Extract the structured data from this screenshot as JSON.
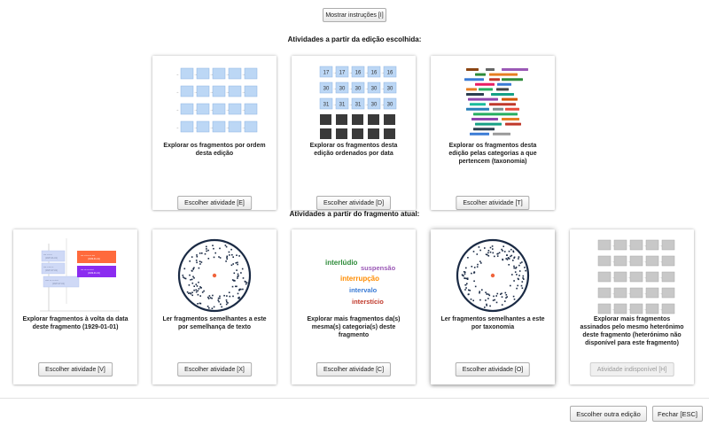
{
  "top": {
    "show_instructions": "Mostrar instruções [I]"
  },
  "sections": {
    "edition": "Atividades a partir da edição escolhida:",
    "fragment": "Atividades a partir do fragmento atual:"
  },
  "edition_cards": [
    {
      "label": "Explorar os fragmentos por ordem desta edição",
      "button": "Escolher atividade [E]"
    },
    {
      "label": "Explorar os fragmentos desta edição ordenados por data",
      "button": "Escolher atividade [D]"
    },
    {
      "label": "Explorar os fragmentos desta edição pelas categorias a que pertencem (taxonomia)",
      "button": "Escolher atividade [T]"
    }
  ],
  "fragment_cards": [
    {
      "label": "Explorar fragmentos à volta da data deste fragmento (1929-01-01)",
      "button": "Escolher atividade [V]"
    },
    {
      "label": "Ler fragmentos semelhantes a este por semelhança de texto",
      "button": "Escolher atividade [X]"
    },
    {
      "label": "Explorar mais fragmentos da(s) mesma(s) categoria(s) deste fragmento",
      "button": "Escolher atividade [C]"
    },
    {
      "label": "Ler fragmentos semelhantes a este por taxonomia",
      "button": "Escolher atividade [O]"
    },
    {
      "label": "Explorar mais fragmentos assinados pelo mesmo heterónimo deste fragmento (heterónimo não disponível para este fragmento)",
      "button": "Atividade indisponível [H]"
    }
  ],
  "thumb_date": {
    "rows": [
      [
        "17",
        "17",
        "16",
        "16",
        "16"
      ],
      [
        "30",
        "30",
        "30",
        "30",
        "30"
      ],
      [
        "31",
        "31",
        "31",
        "30",
        "30"
      ]
    ]
  },
  "thumb_categories": [
    "interlúdio",
    "suspensão",
    "interrupção",
    "intervalo",
    "interstício"
  ],
  "footer": {
    "choose_edition": "Escolher outra edição",
    "close": "Fechar [ESC]"
  },
  "colors": {
    "grid_box": "#bcd7f5",
    "grid_border": "#8db4e2",
    "dark_square": "#3a3a3a",
    "disabled_box": "#c8c8c8",
    "circle": "#1a2a44",
    "center_dot": "#f0643c"
  }
}
